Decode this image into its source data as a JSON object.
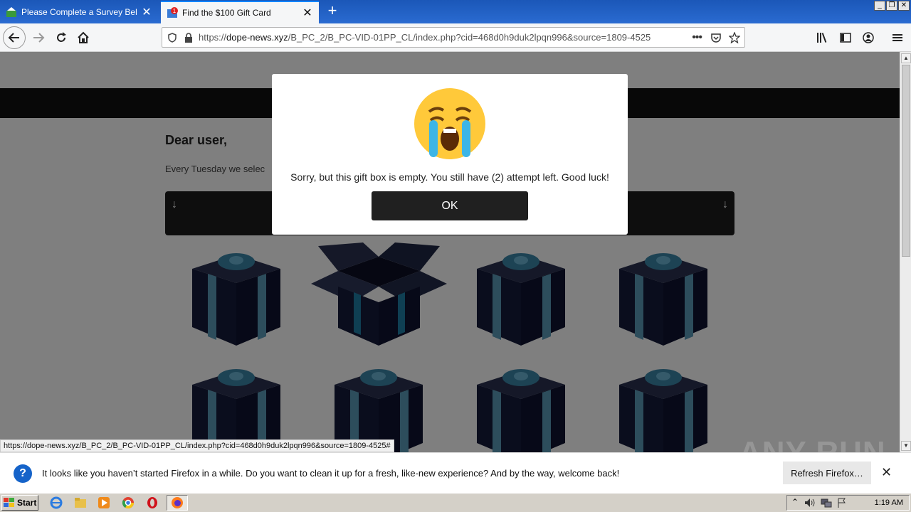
{
  "tabs": [
    {
      "title": "Please Complete a Survey Below t",
      "active": false
    },
    {
      "title": "Find the $100 Gift Card",
      "active": true
    }
  ],
  "new_tab_label": "+",
  "window_controls": [
    "_",
    "❐",
    "✕"
  ],
  "url": {
    "prefix": "https://",
    "host": "dope-news.xyz",
    "path": "/B_PC_2/B_PC-VID-01PP_CL/index.php?cid=468d0h9duk2lpqn996&source=1809-4525"
  },
  "page": {
    "greeting": "Dear user,",
    "intro": "Every Tuesday we selec",
    "banner_arrow": "↓"
  },
  "modal": {
    "emoji": "😭",
    "message": "Sorry, but this gift box is empty. You still have (2) attempt left. Good luck!",
    "ok_label": "OK"
  },
  "status_url": "https://dope-news.xyz/B_PC_2/B_PC-VID-01PP_CL/index.php?cid=468d0h9duk2lpqn996&source=1809-4525#",
  "notification": {
    "text": "It looks like you haven’t started Firefox in a while. Do you want to clean it up for a fresh, like-new experience? And by the way, welcome back!",
    "button": "Refresh Firefox…",
    "close": "✕"
  },
  "watermark": "ANY RUN",
  "taskbar": {
    "start_label": "Start",
    "clock": "1:19 AM"
  },
  "colors": {
    "gift_body": "#151a3a",
    "gift_ribbon": "#5a9bb8",
    "tab_accent": "#0a84ff"
  }
}
